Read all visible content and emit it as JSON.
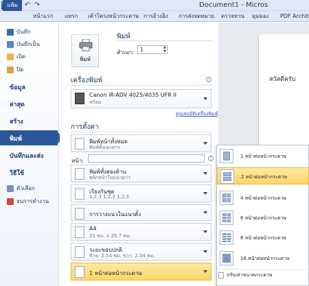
{
  "window": {
    "title": "Document1 - Micros",
    "app_icon": "word-logo",
    "icons": [
      "save-icon",
      "undo-icon",
      "redo-icon"
    ]
  },
  "ribbon": {
    "tabs": [
      "แฟ้ม",
      "หน้าแรก",
      "แทรก",
      "เค้าโครงหน้ากระดาษ",
      "การอ้างอิง",
      "การส่งจดหมาย",
      "ตรวจทาน",
      "มุมมอง",
      "PDF Archite"
    ]
  },
  "sidebar": {
    "commands": [
      {
        "label": "บันทึก",
        "icon": "save-icon"
      },
      {
        "label": "บันทึกเป็น",
        "icon": "save-as-icon"
      },
      {
        "label": "เปิด",
        "icon": "open-folder-icon"
      },
      {
        "label": "ปิด",
        "icon": "close-folder-icon"
      }
    ],
    "sections": [
      "ข้อมูล",
      "ล่าสุด",
      "สร้าง",
      "พิมพ์",
      "บันทึกและส่ง",
      "วิธีใช้"
    ],
    "bottom": [
      {
        "label": "ตัวเลือก",
        "icon": "options-icon"
      },
      {
        "label": "จบการทำงาน",
        "icon": "exit-icon"
      }
    ]
  },
  "print": {
    "header": "พิมพ์",
    "copies_label": "สำเนา:",
    "copies_value": "1",
    "print_button": "พิมพ์"
  },
  "printer": {
    "header": "เครื่องพิมพ์",
    "name": "Canon iR-ADV 4025/4035 UFR II",
    "status": "พร้อม",
    "properties_link": "คุณสมบัติเครื่องพิมพ์"
  },
  "settings": {
    "header": "การตั้งค่า",
    "pages_label": "หน้า:",
    "items": [
      {
        "t1": "พิมพ์หน้าทั้งหมด",
        "t2": "พิมพ์ทั้งเอกสาร"
      },
      {
        "t1": "พิมพ์ทั้งสองด้าน",
        "t2": "พลิกหน้าในแนวยาว"
      },
      {
        "t1": "เรียงกันชุด",
        "t2": "1,2,3    1,2,3    1,2,3"
      },
      {
        "t1": "การวางแนวในแนวตั้ง",
        "t2": ""
      },
      {
        "t1": "A4",
        "t2": "21 ซม. x 29.7 ซม."
      },
      {
        "t1": "ระยะขอบปกติ",
        "t2": "ซ้าย: 2.54 ซม.   ขวา: 2.54 ซม."
      },
      {
        "t1": "1 หน้าต่อหน้ากระดาษ",
        "t2": ""
      }
    ]
  },
  "menu": {
    "items": [
      {
        "label": "1 หน้าต่อหน้ากระดาษ",
        "n": 1
      },
      {
        "label": "2 หน้าต่อหน้ากระดาษ",
        "n": 2,
        "selected": true
      },
      {
        "label": "4 หน้าต่อหน้ากระดาษ",
        "n": 4
      },
      {
        "label": "6 หน้าต่อหน้ากระดาษ",
        "n": 6
      },
      {
        "label": "8 หน้าต่อหน้ากระดาษ",
        "n": 8
      },
      {
        "label": "16 หน้าต่อหน้ากระดาษ",
        "n": 16
      }
    ],
    "scale_label": "ปรับเท่าขนาดกระดาษ"
  },
  "preview": {
    "text": "สวัสดีครับ"
  },
  "colors": {
    "accent": "#2b579a",
    "highlight": "#fbd768"
  }
}
